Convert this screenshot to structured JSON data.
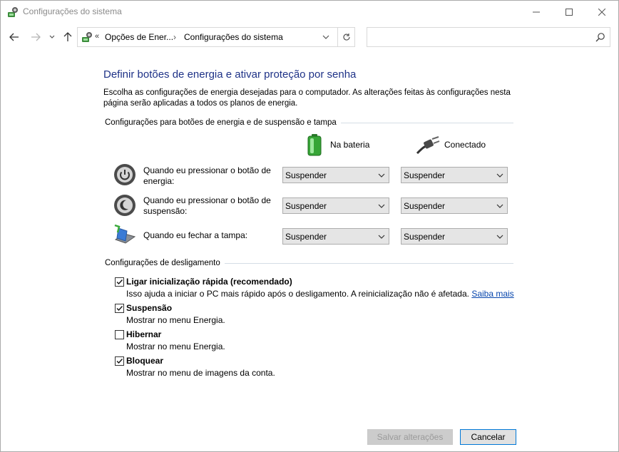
{
  "window": {
    "title": "Configurações do sistema"
  },
  "address": {
    "chevrons": "«",
    "crumbs": [
      "Opções de Ener...",
      "Configurações do sistema"
    ],
    "separator": "›"
  },
  "search": {
    "placeholder": ""
  },
  "page": {
    "title": "Definir botões de energia e ativar proteção por senha",
    "description": "Escolha as configurações de energia desejadas para o computador. As alterações feitas às configurações nesta página serão aplicadas a todos os planos de energia."
  },
  "power_section": {
    "heading": "Configurações para botões de energia e de suspensão e tampa",
    "columns": {
      "battery": "Na bateria",
      "plugged": "Conectado"
    },
    "rows": [
      {
        "label": "Quando eu pressionar o botão de energia:",
        "icon": "power-button-icon",
        "battery": "Suspender",
        "plugged": "Suspender"
      },
      {
        "label": "Quando eu pressionar o botão de suspensão:",
        "icon": "sleep-button-icon",
        "battery": "Suspender",
        "plugged": "Suspender"
      },
      {
        "label": "Quando eu fechar a tampa:",
        "icon": "laptop-lid-icon",
        "battery": "Suspender",
        "plugged": "Suspender"
      }
    ]
  },
  "shutdown_section": {
    "heading": "Configurações de desligamento",
    "items": [
      {
        "label": "Ligar inicialização rápida (recomendado)",
        "desc": "Isso ajuda a iniciar o PC mais rápido após o desligamento. A reinicialização não é afetada.",
        "link": "Saiba mais",
        "checked": true
      },
      {
        "label": "Suspensão",
        "desc": "Mostrar no menu Energia.",
        "checked": true
      },
      {
        "label": "Hibernar",
        "desc": "Mostrar no menu Energia.",
        "checked": false
      },
      {
        "label": "Bloquear",
        "desc": "Mostrar no menu de imagens da conta.",
        "checked": true
      }
    ]
  },
  "buttons": {
    "save": "Salvar alterações",
    "cancel": "Cancelar"
  },
  "colors": {
    "title_blue": "#1e3287",
    "link_blue": "#0645ad",
    "accent": "#0078d7"
  }
}
